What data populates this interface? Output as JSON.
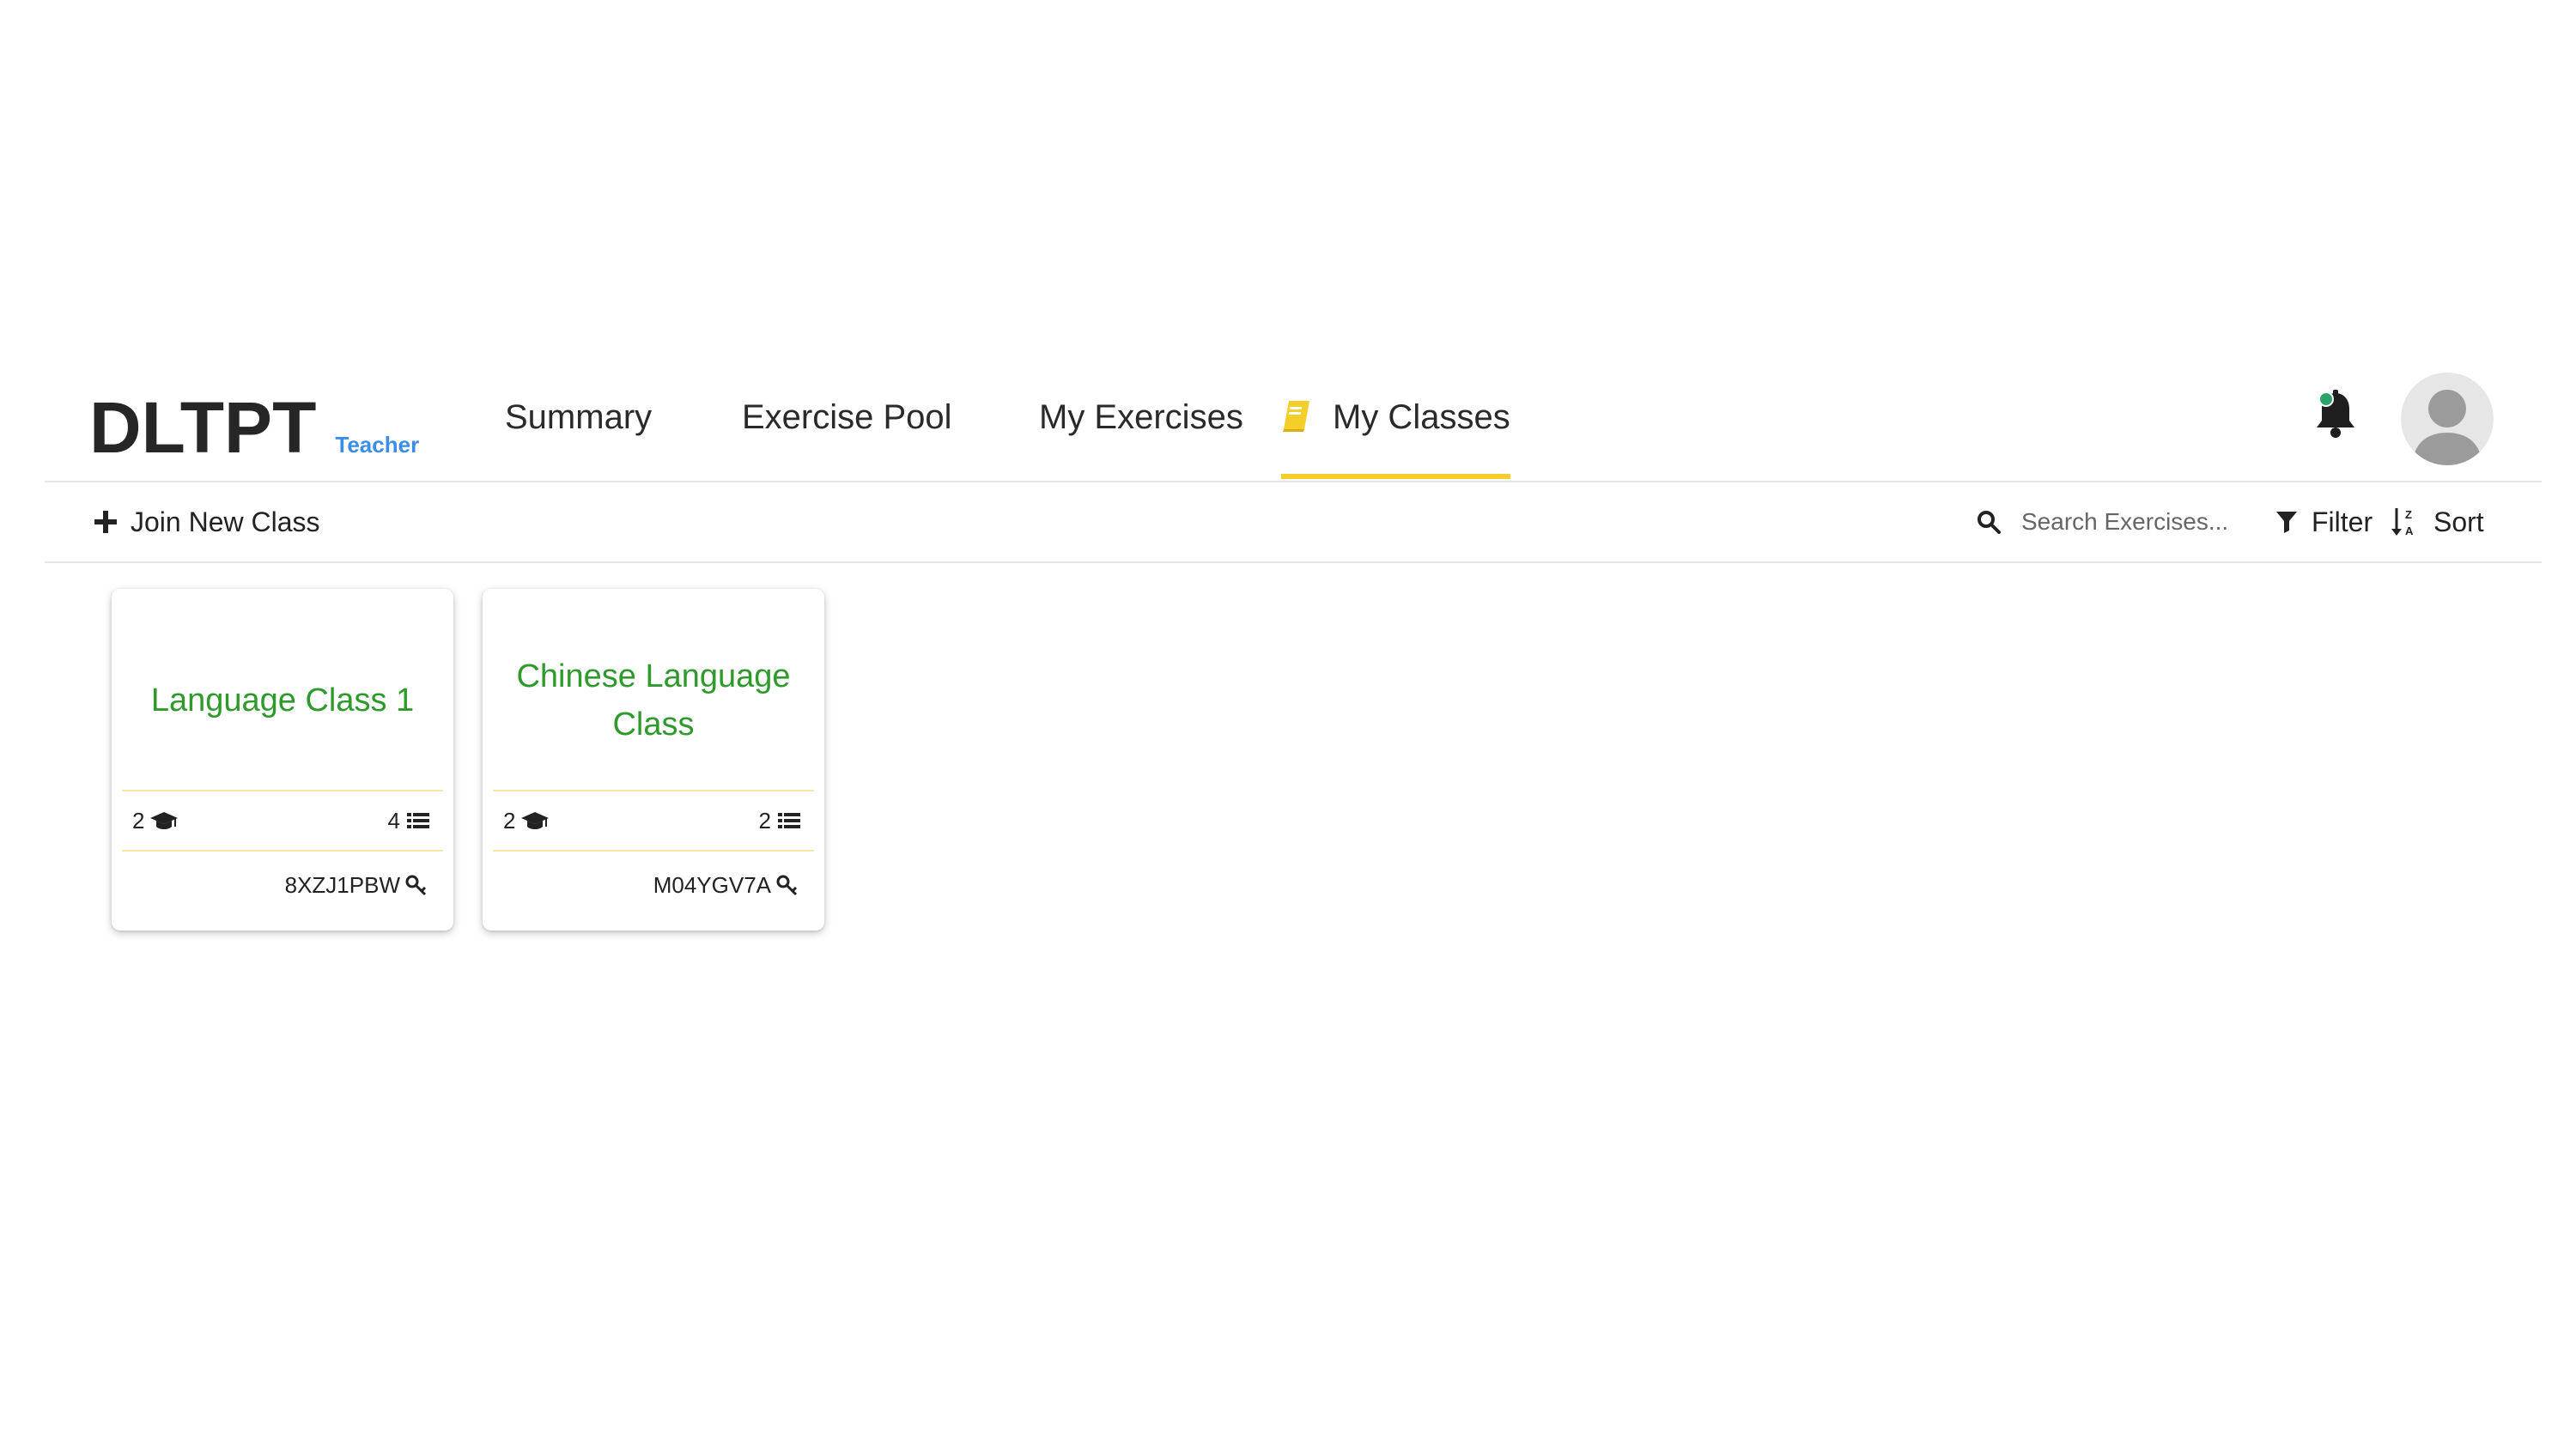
{
  "header": {
    "brand": "DLTPT",
    "role": "Teacher",
    "tabs": [
      {
        "label": "Summary"
      },
      {
        "label": "Exercise Pool"
      },
      {
        "label": "My Exercises"
      },
      {
        "label": "My Classes",
        "active": true,
        "icon": "book-icon"
      }
    ],
    "notification_icon": "bell-icon",
    "avatar_icon": "user-avatar-icon"
  },
  "toolbar": {
    "join_label": "Join New Class",
    "search_placeholder": "Search Exercises...",
    "filter_label": "Filter",
    "sort_label": "Sort"
  },
  "classes": [
    {
      "name": "Language Class 1",
      "students": "2",
      "exercises": "4",
      "code": "8XZJ1PBW"
    },
    {
      "name": "Chinese Language Class",
      "students": "2",
      "exercises": "2",
      "code": "M04YGV7A"
    }
  ],
  "colors": {
    "accent": "#f4cf2b",
    "role": "#3b8ee8",
    "class_title": "#2e9a2c",
    "divider": "#f6e6a6",
    "notification_dot": "#2aa46a"
  }
}
